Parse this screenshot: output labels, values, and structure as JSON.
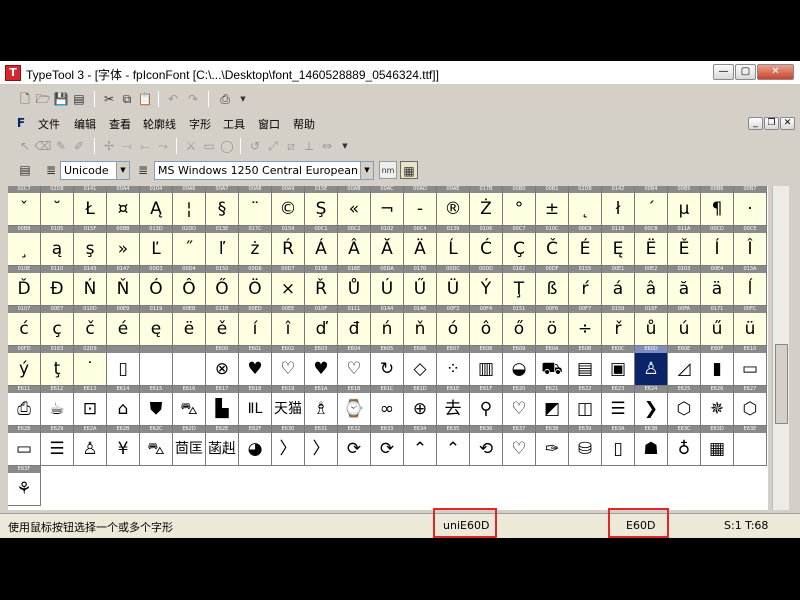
{
  "window": {
    "title": "TypeTool 3 - [字体 - fpIconFont [C:\\...\\Desktop\\font_1460528889_0546324.ttf]]"
  },
  "toolbar_icons": [
    "new-doc-icon",
    "open-folder-icon",
    "save-icon",
    "save-all-icon",
    "cut-icon",
    "copy-icon",
    "paste-icon",
    "undo-icon",
    "redo-icon",
    "print-icon"
  ],
  "menu": [
    "文件",
    "编辑",
    "查看",
    "轮廓线",
    "字形",
    "工具",
    "窗口",
    "帮助"
  ],
  "encoding": {
    "code_page": "Unicode",
    "charset": "MS Windows 1250 Central European"
  },
  "glyphs": [
    [
      "02C7",
      "02D8",
      "0141",
      "00A4",
      "0104",
      "00A6",
      "00A7",
      "00A8",
      "00A9",
      "015E",
      "00AB",
      "00AC",
      "00AD",
      "00AE",
      "017B",
      "00B0",
      "00B1",
      "02DB",
      "0142",
      "00B4",
      "00B5",
      "00B6",
      "00B7"
    ],
    [
      "00B8",
      "0105",
      "015F",
      "00BB",
      "013D",
      "02DD",
      "013E",
      "017C",
      "0154",
      "00C1",
      "00C2",
      "0102",
      "00C4",
      "0139",
      "0106",
      "00C7",
      "010C",
      "00C9",
      "0118",
      "00CB",
      "011A",
      "00CD",
      "00CE"
    ],
    [
      "010E",
      "0110",
      "0143",
      "0147",
      "00D3",
      "00D4",
      "0150",
      "00D6",
      "00D7",
      "0158",
      "016E",
      "00DA",
      "0170",
      "00DC",
      "00DD",
      "0162",
      "00DF",
      "0155",
      "00E1",
      "00E2",
      "0103",
      "00E4",
      "013A"
    ],
    [
      "0107",
      "00E7",
      "010D",
      "00E9",
      "0119",
      "00EB",
      "011B",
      "00ED",
      "00EE",
      "010F",
      "0111",
      "0144",
      "0148",
      "00F3",
      "00F4",
      "0151",
      "00F6",
      "00F7",
      "0159",
      "016F",
      "00FA",
      "0171",
      "00FC"
    ],
    [
      "00FD",
      "0163",
      "02D9",
      "",
      "",
      "",
      "E600",
      "E601",
      "E602",
      "E603",
      "E604",
      "E605",
      "E606",
      "E607",
      "E608",
      "E609",
      "E60A",
      "E60B",
      "E60C",
      "E60D",
      "E60E",
      "E60F",
      "E610"
    ],
    [
      "E611",
      "E612",
      "E613",
      "E614",
      "E615",
      "E616",
      "E617",
      "E618",
      "E619",
      "E61A",
      "E61B",
      "E61C",
      "E61D",
      "E61E",
      "E61F",
      "E620",
      "E621",
      "E622",
      "E623",
      "E624",
      "E625",
      "E626",
      "E627"
    ],
    [
      "E628",
      "E629",
      "E62A",
      "E62B",
      "E62C",
      "E62D",
      "E62E",
      "E62F",
      "E630",
      "E631",
      "E632",
      "E633",
      "E634",
      "E635",
      "E636",
      "E637",
      "E638",
      "E639",
      "E63A",
      "E63B",
      "E63C",
      "E63D",
      "E63E"
    ],
    [
      "E63F"
    ]
  ],
  "glyph_chars": [
    [
      "ˇ",
      "˘",
      "Ł",
      "¤",
      "Ą",
      "¦",
      "§",
      "¨",
      "©",
      "Ş",
      "«",
      "¬",
      "-",
      "®",
      "Ż",
      "°",
      "±",
      "˛",
      "ł",
      "´",
      "µ",
      "¶",
      "·"
    ],
    [
      "¸",
      "ą",
      "ş",
      "»",
      "Ľ",
      "˝",
      "ľ",
      "ż",
      "Ŕ",
      "Á",
      "Â",
      "Ă",
      "Ä",
      "Ĺ",
      "Ć",
      "Ç",
      "Č",
      "É",
      "Ę",
      "Ë",
      "Ě",
      "Í",
      "Î"
    ],
    [
      "Ď",
      "Đ",
      "Ń",
      "Ň",
      "Ó",
      "Ô",
      "Ő",
      "Ö",
      "×",
      "Ř",
      "Ů",
      "Ú",
      "Ű",
      "Ü",
      "Ý",
      "Ţ",
      "ß",
      "ŕ",
      "á",
      "â",
      "ă",
      "ä",
      "ĺ"
    ],
    [
      "ć",
      "ç",
      "č",
      "é",
      "ę",
      "ë",
      "ě",
      "í",
      "î",
      "ď",
      "đ",
      "ń",
      "ň",
      "ó",
      "ô",
      "ő",
      "ö",
      "÷",
      "ř",
      "ů",
      "ú",
      "ű",
      "ü"
    ],
    [
      "ý",
      "ţ",
      "˙",
      "▯",
      "",
      "",
      "⊗",
      "♥",
      "♡",
      "♥",
      "♡",
      "↻",
      "◇",
      "⁘",
      "▥",
      "◒",
      "⛟",
      "▤",
      "▣",
      "♙",
      "◿",
      "▮",
      "▭"
    ],
    [
      "⎙",
      "☕",
      "⊡",
      "⌂",
      "⛊",
      "⛍",
      "▙",
      "ⅡL",
      "天猫",
      "♗",
      "⌚",
      "∞",
      "⊕",
      "去",
      "⚲",
      "♡",
      "◩",
      "◫",
      "☰",
      "❯",
      "⬡",
      "✵",
      "⬡"
    ],
    [
      "▭",
      "☰",
      "♙",
      "¥",
      "⛍",
      "茴匡",
      "菡赳",
      "◕",
      "〉",
      "〉",
      "⟳",
      "⟳",
      "⌃",
      "⌃",
      "⟲",
      "♡",
      "✑",
      "⛁",
      "▯",
      "☗",
      "♁",
      "▦"
    ],
    [
      "⚘"
    ]
  ],
  "selected_code": "E60D",
  "status": {
    "hint": "使用鼠标按钮选择一个或多个字形",
    "glyph_name": "uniE60D",
    "code": "E60D",
    "size": "S:1 T:68"
  },
  "colors": {
    "selection": "#0a246a",
    "highlight": "#e0282a",
    "cell_latin": "#ffffe1"
  }
}
